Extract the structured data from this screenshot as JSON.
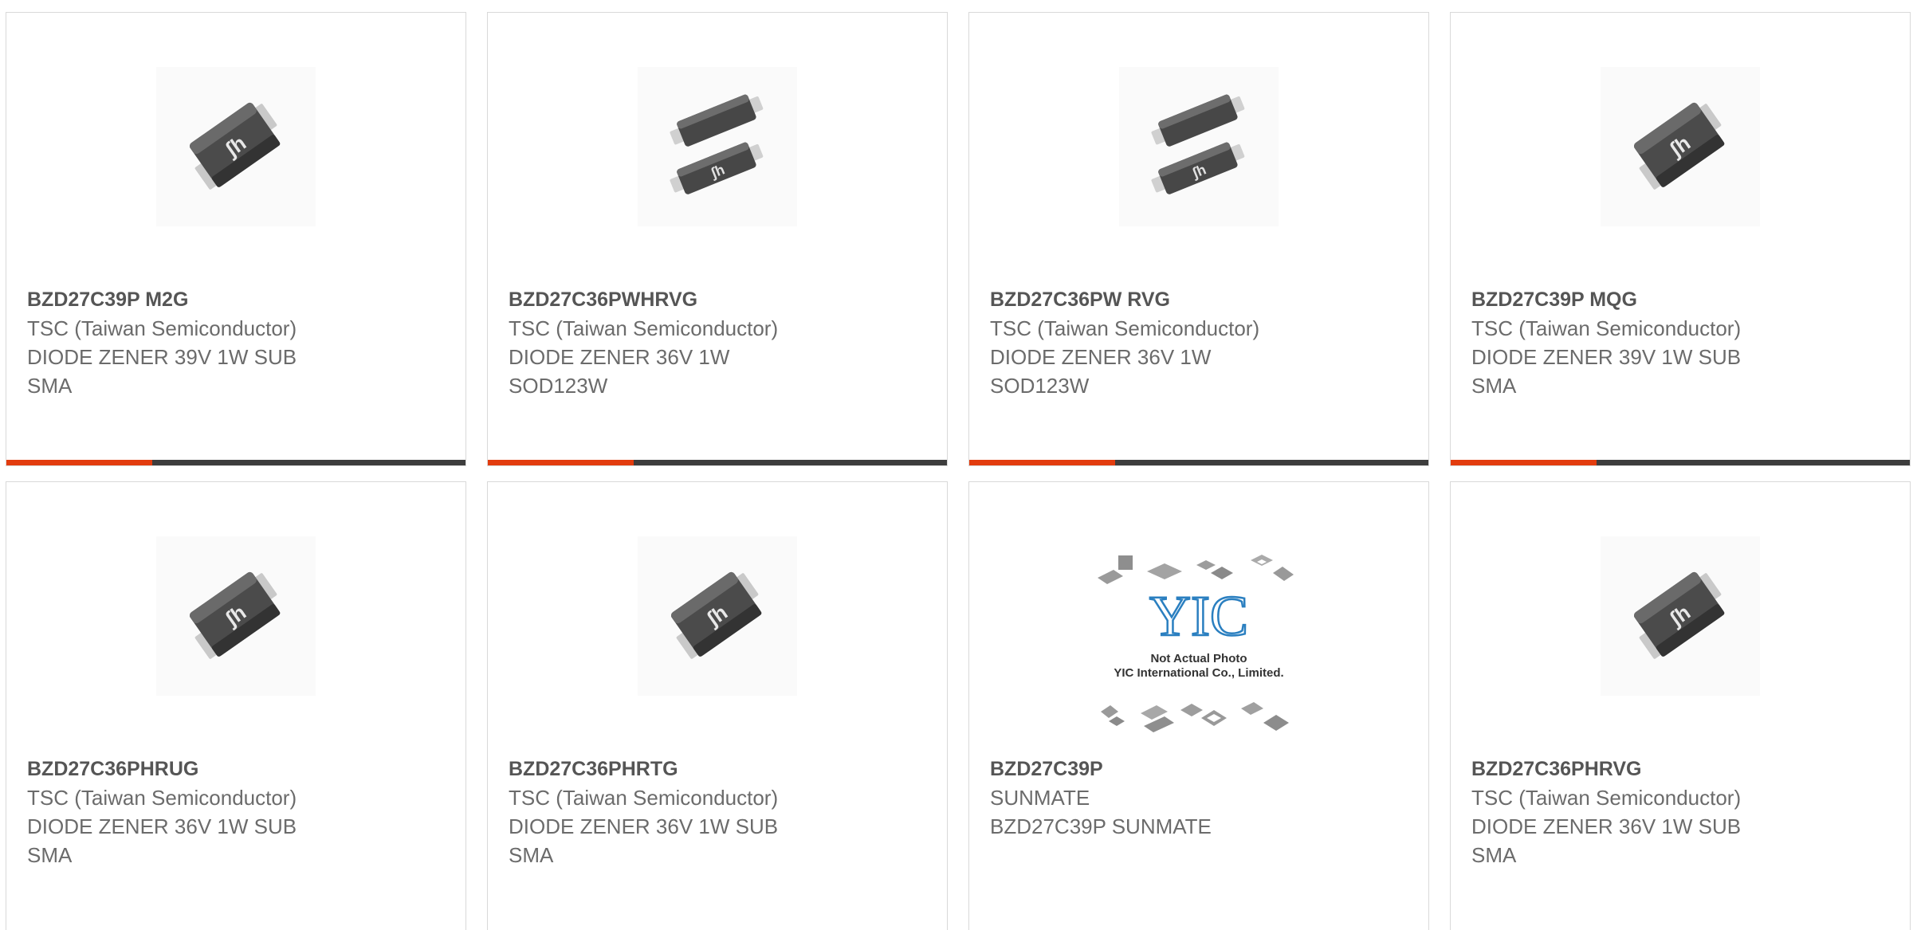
{
  "colors": {
    "accent": "#e23c0e",
    "bar": "#3d3d3d",
    "border": "#d9d9d9",
    "part_text": "#555555",
    "body_text": "#6b6b6b"
  },
  "products": [
    {
      "part": "BZD27C39P M2G",
      "manufacturer": "TSC (Taiwan Semiconductor)",
      "desc_line1": "DIODE ZENER 39V 1W SUB",
      "desc_line2": "SMA",
      "image": "sma-diode-package-icon"
    },
    {
      "part": "BZD27C36PWHRVG",
      "manufacturer": "TSC (Taiwan Semiconductor)",
      "desc_line1": "DIODE ZENER 36V 1W",
      "desc_line2": "SOD123W",
      "image": "sod123w-diode-package-icon"
    },
    {
      "part": "BZD27C36PW RVG",
      "manufacturer": "TSC (Taiwan Semiconductor)",
      "desc_line1": "DIODE ZENER 36V 1W",
      "desc_line2": "SOD123W",
      "image": "sod123w-diode-package-icon"
    },
    {
      "part": "BZD27C39P MQG",
      "manufacturer": "TSC (Taiwan Semiconductor)",
      "desc_line1": "DIODE ZENER 39V 1W SUB",
      "desc_line2": "SMA",
      "image": "sma-diode-package-icon"
    },
    {
      "part": "BZD27C36PHRUG",
      "manufacturer": "TSC (Taiwan Semiconductor)",
      "desc_line1": "DIODE ZENER 36V 1W SUB",
      "desc_line2": "SMA",
      "image": "sma-diode-package-icon"
    },
    {
      "part": "BZD27C36PHRTG",
      "manufacturer": "TSC (Taiwan Semiconductor)",
      "desc_line1": "DIODE ZENER 36V 1W SUB",
      "desc_line2": "SMA",
      "image": "sma-diode-package-icon"
    },
    {
      "part": "BZD27C39P",
      "manufacturer": "SUNMATE",
      "desc_line1": "BZD27C39P SUNMATE",
      "desc_line2": "",
      "image": "not-actual-photo-placeholder",
      "placeholder_logo": "YIC",
      "placeholder_line1": "Not Actual Photo",
      "placeholder_line2": "YIC International Co., Limited."
    },
    {
      "part": "BZD27C36PHRVG",
      "manufacturer": "TSC (Taiwan Semiconductor)",
      "desc_line1": "DIODE ZENER 36V 1W SUB",
      "desc_line2": "SMA",
      "image": "sma-diode-package-icon"
    }
  ]
}
